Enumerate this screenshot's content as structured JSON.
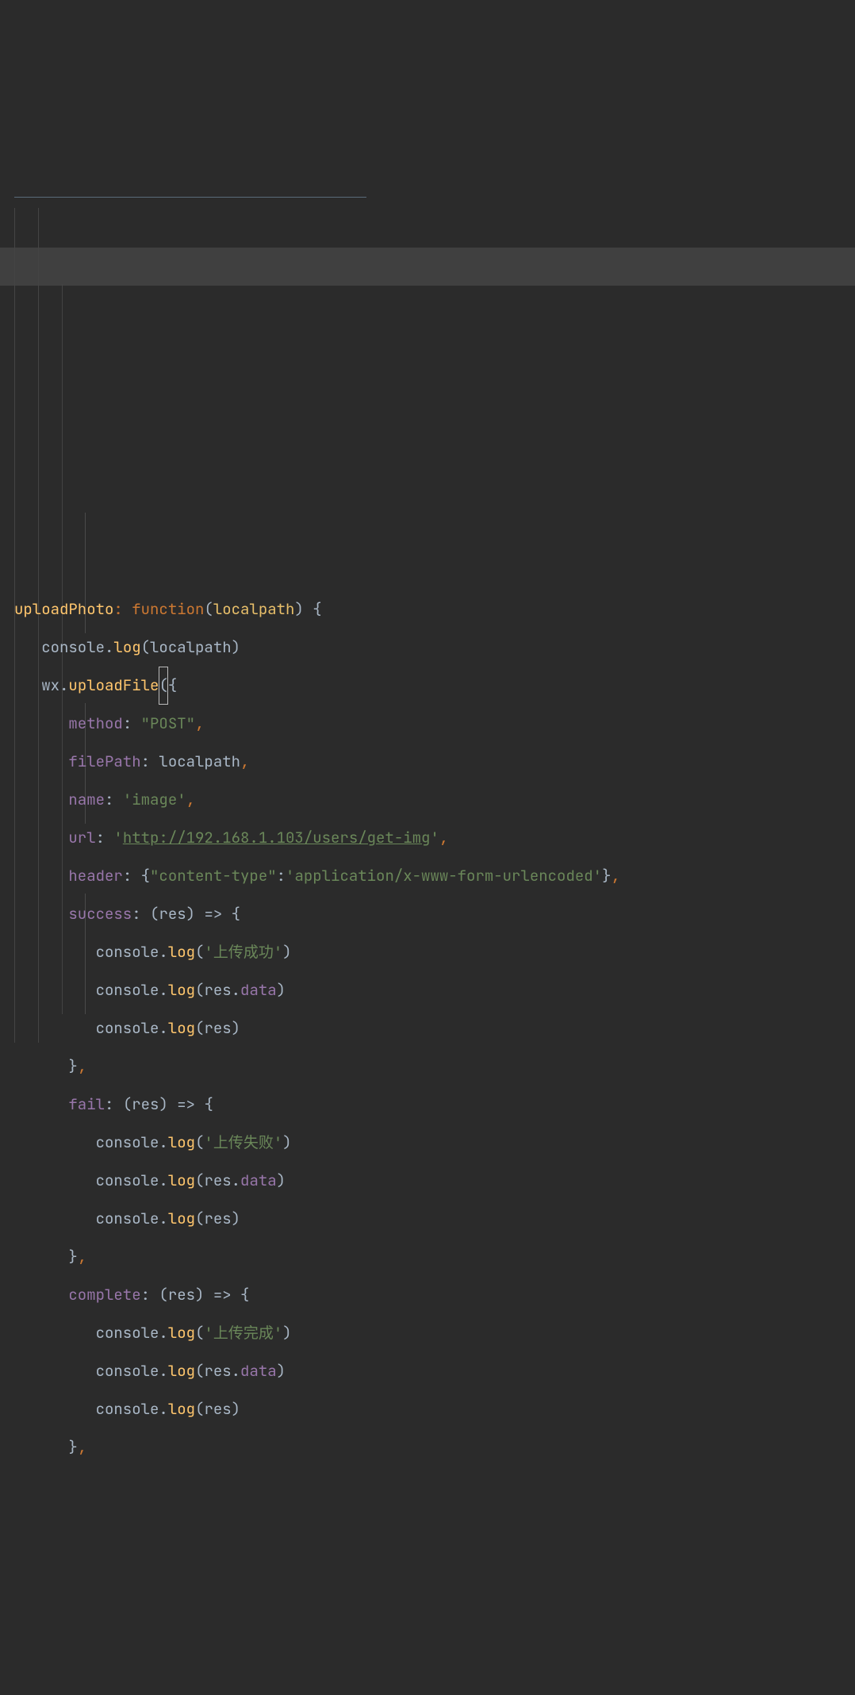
{
  "line1": {
    "funcName": "uploadPhoto",
    "colon": ":",
    "sp": " ",
    "functionKw": "function",
    "open": "(",
    "param": "localpath",
    "close": ")",
    "brace": " {"
  },
  "line2": {
    "indent": "   ",
    "console": "console",
    "dot": ".",
    "log": "log",
    "open": "(",
    "arg": "localpath",
    "close": ")"
  },
  "line3": {
    "indent": "   ",
    "wx": "wx",
    "dot": ".",
    "upload": "uploadFile",
    "open": "(",
    "brace": "{"
  },
  "line4": {
    "indent": "      ",
    "key": "method",
    "colon": ": ",
    "val": "\"POST\"",
    "comma": ","
  },
  "line5": {
    "indent": "      ",
    "key": "filePath",
    "colon": ": ",
    "val": "localpath",
    "comma": ","
  },
  "line6": {
    "indent": "      ",
    "key": "name",
    "colon": ": ",
    "val": "'image'",
    "comma": ","
  },
  "line7": {
    "indent": "      ",
    "key": "url",
    "colon": ": ",
    "q1": "'",
    "val": "http://192.168.1.103/users/get-img",
    "q2": "'",
    "comma": ","
  },
  "line8": {
    "indent": "      ",
    "key": "header",
    "colon": ": ",
    "open": "{",
    "hkey": "\"content-type\"",
    "hcolon": ":",
    "hval": "'application/x-www-form-urlencoded'",
    "close": "}",
    "comma": ","
  },
  "line9": {
    "indent": "      ",
    "key": "success",
    "colon": ": ",
    "open": "(",
    "param": "res",
    "close": ")",
    "arrow": " => ",
    "brace": "{"
  },
  "inner": {
    "indent": "         ",
    "console": "console",
    "dot": ".",
    "log": "log",
    "open": "(",
    "close": ")",
    "resdata_res": "res",
    "resdata_dot": ".",
    "resdata_data": "data",
    "res": "res"
  },
  "messages": {
    "success": "'上传成功'",
    "fail": "'上传失败'",
    "complete": "'上传完成'"
  },
  "closeInner": {
    "indent": "      ",
    "brace": "}",
    "comma": ","
  },
  "line15": {
    "indent": "      ",
    "key": "fail",
    "colon": ": ",
    "open": "(",
    "param": "res",
    "close": ")",
    "arrow": " => ",
    "brace": "{"
  },
  "line21": {
    "indent": "      ",
    "key": "complete",
    "colon": ": ",
    "open": "(",
    "param": "res",
    "close": ")",
    "arrow": " => ",
    "brace": "{"
  }
}
